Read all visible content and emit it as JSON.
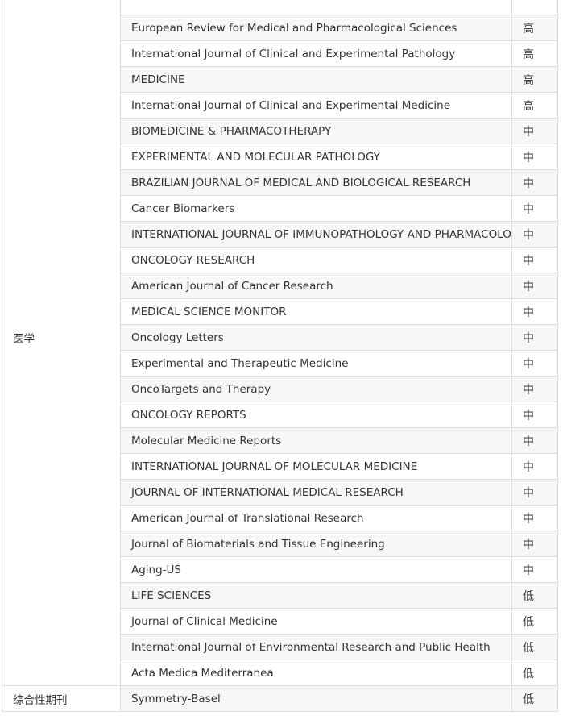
{
  "groups": [
    {
      "subject": "医学",
      "rows": [
        {
          "journal": "",
          "risk": ""
        },
        {
          "journal": "European Review for Medical and Pharmacological Sciences",
          "risk": "高"
        },
        {
          "journal": "International Journal of Clinical and Experimental Pathology",
          "risk": "高"
        },
        {
          "journal": "MEDICINE",
          "risk": "高"
        },
        {
          "journal": "International Journal of Clinical and Experimental Medicine",
          "risk": "高"
        },
        {
          "journal": "BIOMEDICINE & PHARMACOTHERAPY",
          "risk": "中"
        },
        {
          "journal": "EXPERIMENTAL AND MOLECULAR PATHOLOGY",
          "risk": "中"
        },
        {
          "journal": "BRAZILIAN JOURNAL OF MEDICAL AND BIOLOGICAL RESEARCH",
          "risk": "中"
        },
        {
          "journal": "Cancer Biomarkers",
          "risk": "中"
        },
        {
          "journal": "INTERNATIONAL JOURNAL OF IMMUNOPATHOLOGY AND PHARMACOLOGY",
          "risk": "中"
        },
        {
          "journal": "ONCOLOGY RESEARCH",
          "risk": "中"
        },
        {
          "journal": "American Journal of Cancer Research",
          "risk": "中"
        },
        {
          "journal": "MEDICAL SCIENCE MONITOR",
          "risk": "中"
        },
        {
          "journal": "Oncology Letters",
          "risk": "中"
        },
        {
          "journal": "Experimental and Therapeutic Medicine",
          "risk": "中"
        },
        {
          "journal": "OncoTargets and Therapy",
          "risk": "中"
        },
        {
          "journal": "ONCOLOGY REPORTS",
          "risk": "中"
        },
        {
          "journal": "Molecular Medicine Reports",
          "risk": "中"
        },
        {
          "journal": "INTERNATIONAL JOURNAL OF MOLECULAR MEDICINE",
          "risk": "中"
        },
        {
          "journal": "JOURNAL OF INTERNATIONAL MEDICAL RESEARCH",
          "risk": "中"
        },
        {
          "journal": "American Journal of Translational Research",
          "risk": "中"
        },
        {
          "journal": "Journal of Biomaterials and Tissue Engineering",
          "risk": "中"
        },
        {
          "journal": "Aging-US",
          "risk": "中"
        },
        {
          "journal": "LIFE SCIENCES",
          "risk": "低"
        },
        {
          "journal": "Journal of Clinical Medicine",
          "risk": "低"
        },
        {
          "journal": "International Journal of Environmental Research and Public Health",
          "risk": "低"
        },
        {
          "journal": "Acta Medica Mediterranea",
          "risk": "低"
        }
      ]
    },
    {
      "subject": "综合性期刊",
      "rows": [
        {
          "journal": "Symmetry-Basel",
          "risk": "低"
        }
      ]
    }
  ]
}
